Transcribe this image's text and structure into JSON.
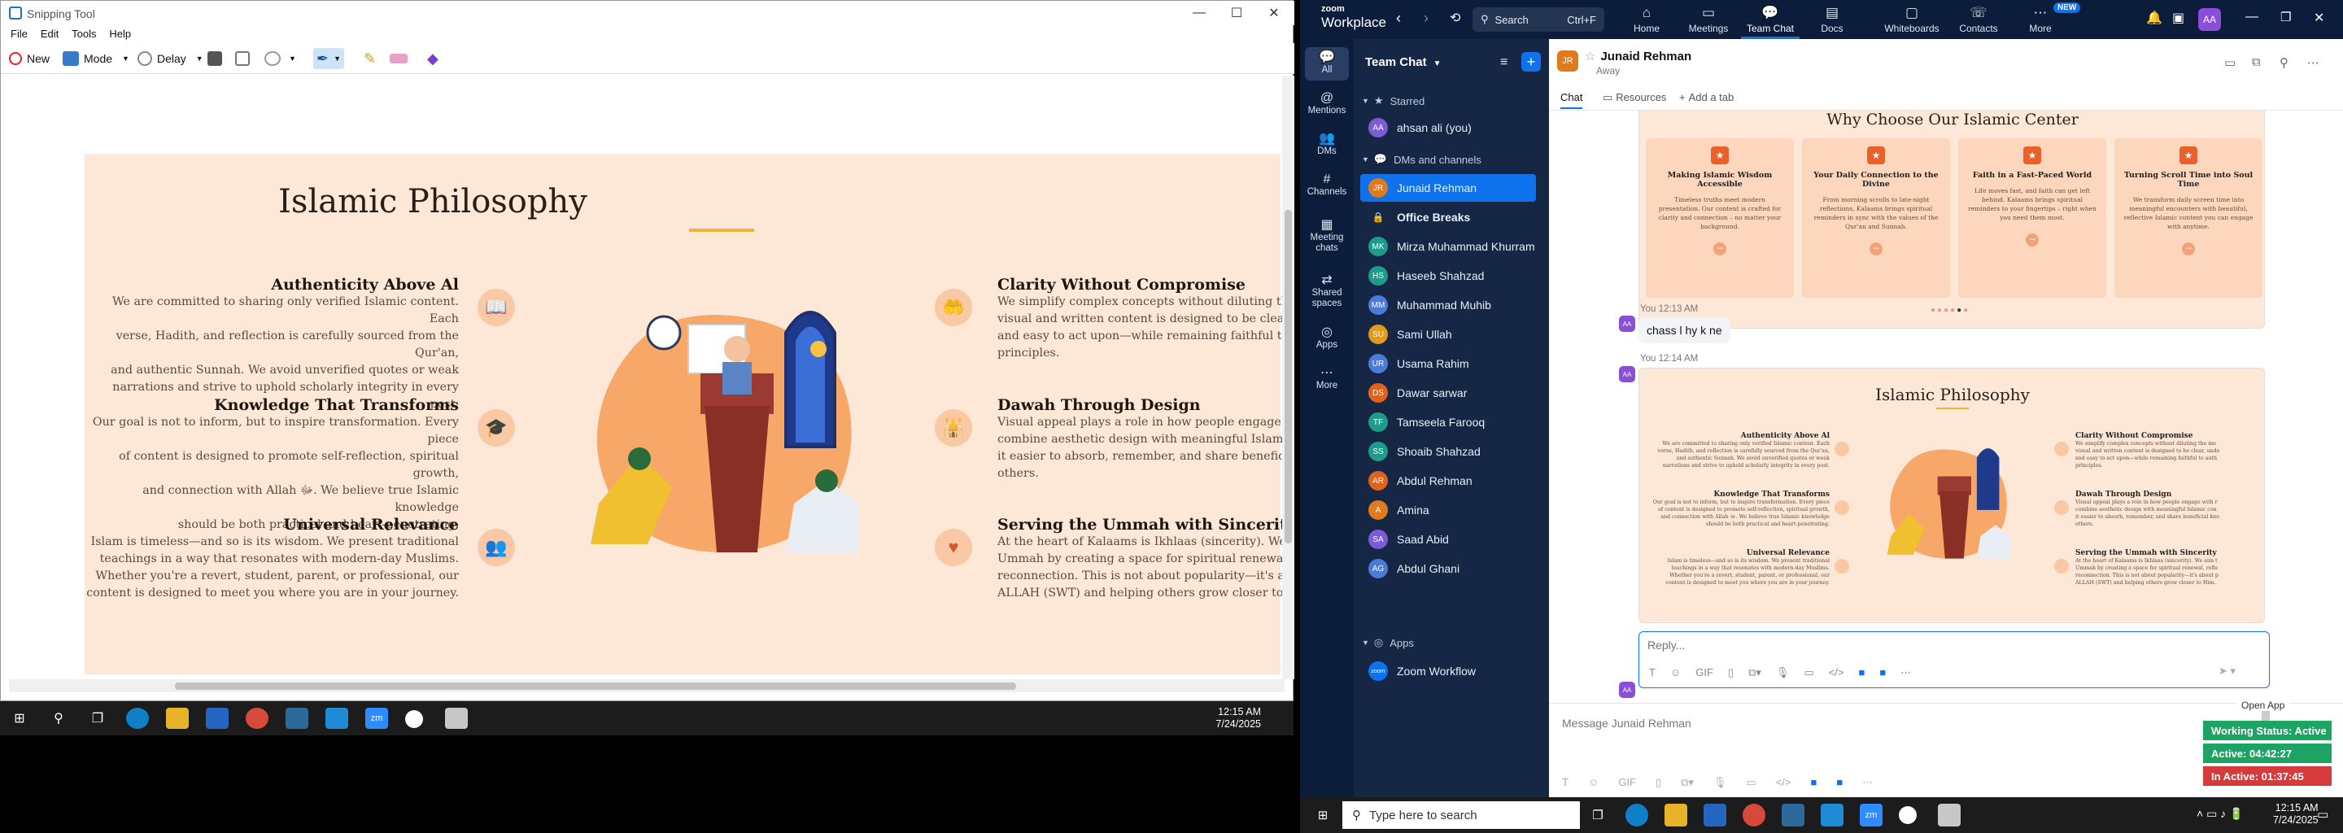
{
  "snip": {
    "title": "Snipping Tool",
    "menu": [
      "File",
      "Edit",
      "Tools",
      "Help"
    ],
    "toolbar": {
      "new": "New",
      "mode": "Mode",
      "delay": "Delay"
    },
    "window_controls": {
      "min": "—",
      "max": "☐",
      "close": "✕"
    }
  },
  "slide": {
    "title": "Islamic Philosophy",
    "features_left": [
      {
        "heading": "Authenticity Above Al",
        "text": [
          "We are committed to sharing only verified Islamic content. Each",
          "verse, Hadith, and reflection is carefully sourced from the Qur'an,",
          "and authentic Sunnah. We avoid unverified quotes or weak",
          "narrations and strive to uphold scholarly integrity in every post."
        ],
        "icon": "book-icon"
      },
      {
        "heading": "Knowledge That Transforms",
        "text": [
          "Our goal is not to inform, but to inspire transformation. Every piece",
          "of content is designed to promote self-reflection, spiritual growth,",
          "and connection with Allah ﷻ. We believe true Islamic knowledge",
          "should be both practical and heart-penetrating."
        ],
        "icon": "graduation-cap-icon"
      },
      {
        "heading": "Universal Relevance",
        "text": [
          "Islam is timeless—and so is its wisdom. We present traditional",
          "teachings in a way that resonates with modern-day Muslims.",
          "Whether you're a revert, student, parent, or professional, our",
          "content is designed to meet you where you are in your journey."
        ],
        "icon": "users-icon"
      }
    ],
    "features_right": [
      {
        "heading": "Clarity Without Compromise",
        "text": [
          "We simplify complex concepts without diluting the me",
          "visual and written content is designed to be clear, unde",
          "and easy to act upon—while remaining faithful to auth",
          "principles."
        ],
        "icon": "hand-heart-icon"
      },
      {
        "heading": "Dawah Through Design",
        "text": [
          "Visual appeal plays a role in how people engage with r",
          "combine aesthetic design with meaningful Islamic con",
          "it easier to absorb, remember, and share beneficial kno",
          "others."
        ],
        "icon": "mosque-icon"
      },
      {
        "heading": "Serving the Ummah with Sincerity",
        "text": [
          "At the heart of Kalaams is Ikhlaas (sincerity). We aim t",
          "Ummah by creating a space for spiritual renewal, refle",
          "reconnection. This is not about popularity—it's about p",
          "ALLAH (SWT) and helping others grow closer to Him."
        ],
        "icon": "heart-icon"
      }
    ]
  },
  "taskbar1": {
    "time": "12:15 AM",
    "date": "7/24/2025"
  },
  "zoom": {
    "brand_top": "zoom",
    "brand": "Workplace",
    "search": "Search",
    "search_shortcut": "Ctrl+F",
    "nav": [
      "Home",
      "Meetings",
      "Team Chat",
      "Docs",
      "Whiteboards",
      "Contacts",
      "More"
    ],
    "new_badge": "NEW",
    "avatar_initials": "AA",
    "rail": [
      "All",
      "Mentions",
      "DMs",
      "Channels",
      "Meeting chats",
      "Shared spaces",
      "Apps",
      "More"
    ],
    "list_title": "Team Chat",
    "sections": {
      "starred": "Starred",
      "dms": "DMs and channels",
      "apps": "Apps"
    },
    "starred": [
      {
        "initials": "AA",
        "name": "ahsan ali (you)",
        "color": "#7b5bd6"
      }
    ],
    "contacts": [
      {
        "initials": "JR",
        "name": "Junaid Rehman",
        "color": "#e07a1f",
        "selected": true
      },
      {
        "initials": "",
        "name": "Office Breaks",
        "color": "",
        "bold": true
      },
      {
        "initials": "MK",
        "name": "Mirza Muhammad Khurram",
        "color": "#1e9b8a"
      },
      {
        "initials": "HS",
        "name": "Haseeb Shahzad",
        "color": "#1e9b8a"
      },
      {
        "initials": "MM",
        "name": "Muhammad Muhib",
        "color": "#4b7bd6"
      },
      {
        "initials": "SU",
        "name": "Sami Ullah",
        "color": "#e09a1f"
      },
      {
        "initials": "UR",
        "name": "Usama Rahim",
        "color": "#4b7bd6"
      },
      {
        "initials": "DS",
        "name": "Dawar sarwar",
        "color": "#e0621f"
      },
      {
        "initials": "TF",
        "name": "Tamseela Farooq",
        "color": "#1e9b8a"
      },
      {
        "initials": "SS",
        "name": "Shoaib Shahzad",
        "color": "#1e9b8a"
      },
      {
        "initials": "AR",
        "name": "Abdul Rehman",
        "color": "#e0621f"
      },
      {
        "initials": "A",
        "name": "Amina",
        "color": "#e07a1f"
      },
      {
        "initials": "SA",
        "name": "Saad Abid",
        "color": "#7b5bd6"
      },
      {
        "initials": "AG",
        "name": "Abdul Ghani",
        "color": "#4b7bd6"
      }
    ],
    "apps": [
      {
        "name": "Zoom Workflow"
      }
    ],
    "chat": {
      "header_initials": "JR",
      "header_name": "Junaid Rehman",
      "header_status": "Away",
      "tabs": [
        "Chat",
        "Resources",
        "Add a tab"
      ],
      "msg1_time": "You 12:13 AM",
      "msg1_text": "chass l hy k ne",
      "msg2_time": "You 12:14 AM",
      "img1_title": "Why Choose Our Islamic Center",
      "img1_cards": [
        {
          "title": "Making Islamic Wisdom Accessible",
          "text": "Timeless truths meet modern presentation. Our content is crafted for clarity and connection – no matter your background."
        },
        {
          "title": "Your Daily Connection to the Divine",
          "text": "From morning scrolls to late-night reflections, Kalaams brings spiritual reminders in sync with the values of the Qur'an and Sunnah."
        },
        {
          "title": "Faith in a Fast-Paced World",
          "text": "Life moves fast, and faith can get left behind. Kalaams brings spiritual reminders to your fingertips – right when you need them most."
        },
        {
          "title": "Turning Scroll Time into Soul Time",
          "text": "We transform daily screen time into meaningful encounters with beautiful, reflective Islamic content you can engage with anytime."
        }
      ],
      "reply_placeholder": "Reply...",
      "message_placeholder": "Message Junaid Rehman",
      "open_app": "Open App"
    },
    "status": {
      "working": "Working Status: Active",
      "active": "Active: 04:42:27",
      "inactive": "In Active: 01:37:45"
    }
  },
  "taskbar2": {
    "search": "Type here to search",
    "time": "12:15 AM",
    "date": "7/24/2025"
  }
}
